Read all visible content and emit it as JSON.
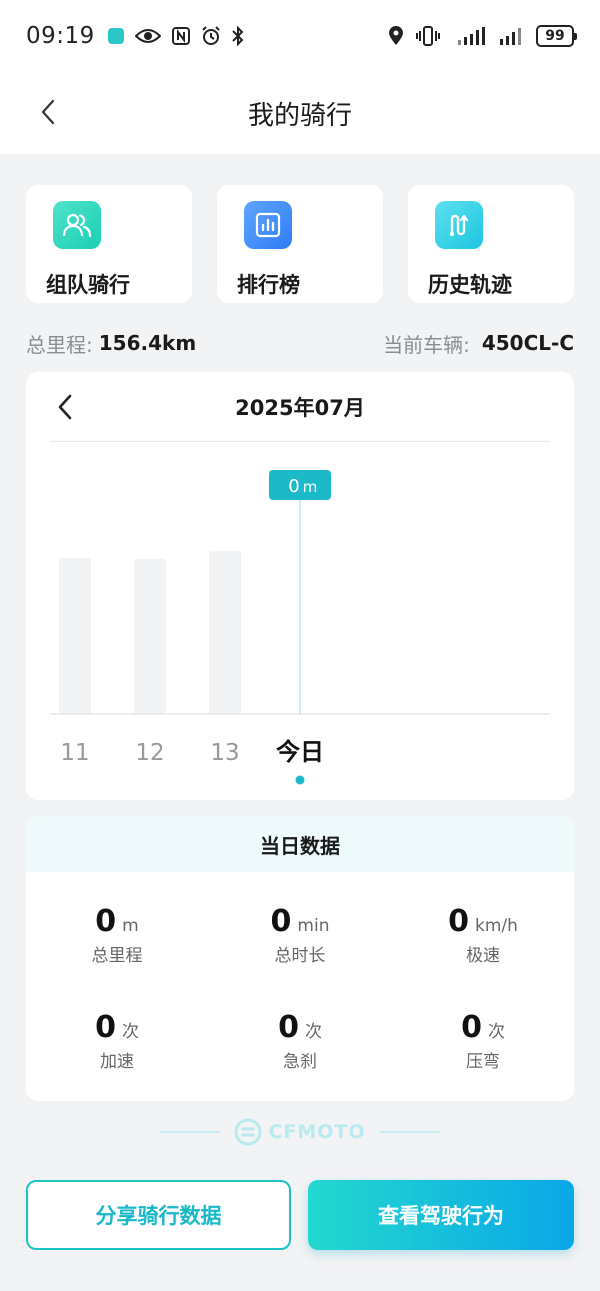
{
  "status_bar": {
    "time": "09:19",
    "battery": "99",
    "icons": [
      "app-notification-icon",
      "eye-icon",
      "nfc-icon",
      "alarm-icon",
      "bluetooth-icon",
      "location-icon",
      "vibrate-icon",
      "signal-icon",
      "signal-icon"
    ]
  },
  "nav": {
    "title": "我的骑行",
    "back_icon": "chevron-left-icon"
  },
  "quick_actions": [
    {
      "label": "组队骑行",
      "icon": "team-icon"
    },
    {
      "label": "排行榜",
      "icon": "ranking-chart-icon"
    },
    {
      "label": "历史轨迹",
      "icon": "route-history-icon"
    }
  ],
  "summary": {
    "total_label": "总里程:",
    "total_value": "156.4km",
    "vehicle_label": "当前车辆:",
    "vehicle_value": "450CL-C"
  },
  "chart_data": {
    "type": "bar",
    "title": "2025年07月",
    "categories": [
      "11",
      "12",
      "13",
      "今日"
    ],
    "values": [
      31,
      30.8,
      32.4,
      0
    ],
    "selected_index": 3,
    "tooltip_value": "0",
    "tooltip_unit": "m",
    "ylim": [
      0,
      50
    ],
    "grid": false
  },
  "day_stats": {
    "title": "当日数据",
    "items": [
      {
        "value": "0",
        "unit": "m",
        "label": "总里程"
      },
      {
        "value": "0",
        "unit": "min",
        "label": "总时长"
      },
      {
        "value": "0",
        "unit": "km/h",
        "label": "极速"
      },
      {
        "value": "0",
        "unit": "次",
        "label": "加速"
      },
      {
        "value": "0",
        "unit": "次",
        "label": "急刹"
      },
      {
        "value": "0",
        "unit": "次",
        "label": "压弯"
      }
    ]
  },
  "brand": {
    "name": "CFMOTO"
  },
  "actions": {
    "share_label": "分享骑行数据",
    "view_label": "查看驾驶行为"
  },
  "colors": {
    "accent": "#19b8c6",
    "bar": "#f2f3f5",
    "tooltip": "#1cbac8"
  }
}
